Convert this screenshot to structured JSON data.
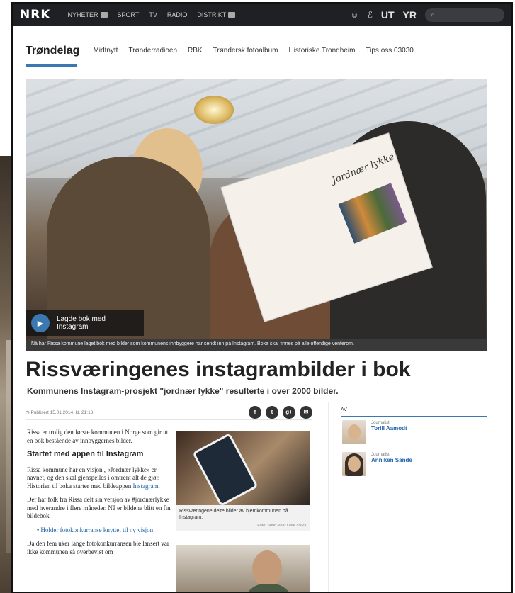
{
  "topbar": {
    "logo": "NRK",
    "nav": [
      {
        "label": "NYHETER",
        "has_dropdown": true
      },
      {
        "label": "SPORT",
        "has_dropdown": false
      },
      {
        "label": "TV",
        "has_dropdown": false
      },
      {
        "label": "RADIO",
        "has_dropdown": false
      },
      {
        "label": "DISTRIKT",
        "has_dropdown": true
      }
    ],
    "ut": "UT",
    "yr": "YR",
    "search_icon": "search-icon"
  },
  "section_nav": {
    "brand": "Trøndelag",
    "items": [
      "Midtnytt",
      "Trønderradioen",
      "RBK",
      "Trøndersk fotoalbum",
      "Historiske Trondheim",
      "Tips oss 03030"
    ]
  },
  "hero": {
    "video_title": "Lagde bok med Instagram",
    "book_title": "Jordnær lykke",
    "caption": "Nå har Rissa kommune laget bok med bilder som kommunens innbyggere har sendt inn på Instagram. Boka skal finnes på alle offentlige venterom."
  },
  "article": {
    "headline": "Rissværingenes instagrambilder i bok",
    "lead": "Kommunens Instagram-prosjekt \"jordnær lykke\" resulterte i over 2000 bilder.",
    "published": "Publisert 15.01.2014, kl. 21:18",
    "share_icons": [
      "facebook-icon",
      "twitter-icon",
      "google-plus-icon",
      "email-icon"
    ],
    "share_glyphs": [
      "f",
      "t",
      "g+",
      "✉"
    ],
    "p1": "Rissa er trolig den første kommunen i Norge som gir ut en bok bestående av innbyggernes bilder.",
    "subheading": "Startet med appen til Instagram",
    "p2_text": "Rissa kommune har en visjon , «Jordnær lykke» er navnet, og den skal gjenspeiles i omtrent alt de gjør. Historien til boka starter med bildeappen ",
    "p2_link": "Instagram",
    "p2_end": ".",
    "p3": "Der har folk fra Rissa delt sin versjon av #jordnærlykke med hverandre i flere måneder. Nå er bildene blitt en fin bildebok.",
    "bullet_link": "Holder fotokonkurranse knyttet til ny visjon",
    "p4": "Da den fem uker lange fotokonkurransen ble lansert var ikke kommunen så overbevist om"
  },
  "figure1": {
    "caption": "Rissværingene delte bilder av hjemkommunen på Instagram.",
    "credit": "Foto: Stein Roar Leite / NRK"
  },
  "authors": {
    "heading": "AV",
    "list": [
      {
        "role": "Journalist",
        "name": "Torill Aamodt"
      },
      {
        "role": "Journalist",
        "name": "Anniken Sande"
      }
    ]
  }
}
